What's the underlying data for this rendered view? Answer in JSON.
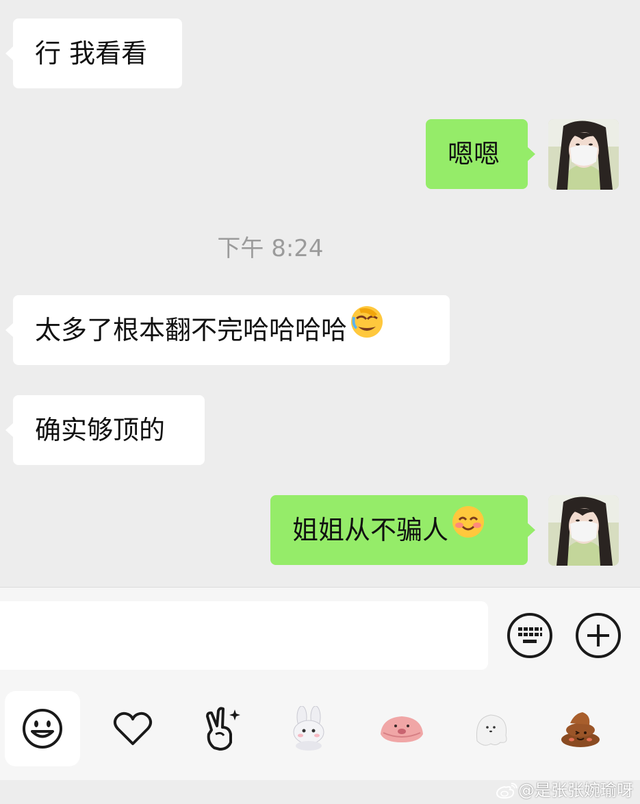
{
  "messages": [
    {
      "side": "in",
      "text": "行 我看看"
    },
    {
      "side": "out",
      "text": "嗯嗯"
    },
    {
      "side": "in",
      "text": "太多了根本翻不完哈哈哈哈",
      "emoji": "facepalm-laughing-emoji"
    },
    {
      "side": "in",
      "text": "确实够顶的"
    },
    {
      "side": "out",
      "text": "姐姐从不骗人",
      "emoji": "smiling-blush-emoji"
    }
  ],
  "timestamp": "下午 8:24",
  "input": {
    "value": "",
    "placeholder": ""
  },
  "input_bar": {
    "buttons": [
      "keyboard-icon",
      "plus-icon"
    ]
  },
  "emoji_tray": {
    "items": [
      "smiley-icon",
      "heart-icon",
      "victory-hand-icon",
      "bunny-sticker",
      "blob-sticker",
      "ghost-sticker",
      "poop-sticker"
    ],
    "active_index": 0
  },
  "watermark": {
    "icon": "weibo-icon",
    "text": "@是张张婉瑜呀"
  },
  "colors": {
    "background": "#ededed",
    "incoming_bubble": "#ffffff",
    "outgoing_bubble": "#95ec69",
    "timestamp": "#9b9b9b"
  }
}
